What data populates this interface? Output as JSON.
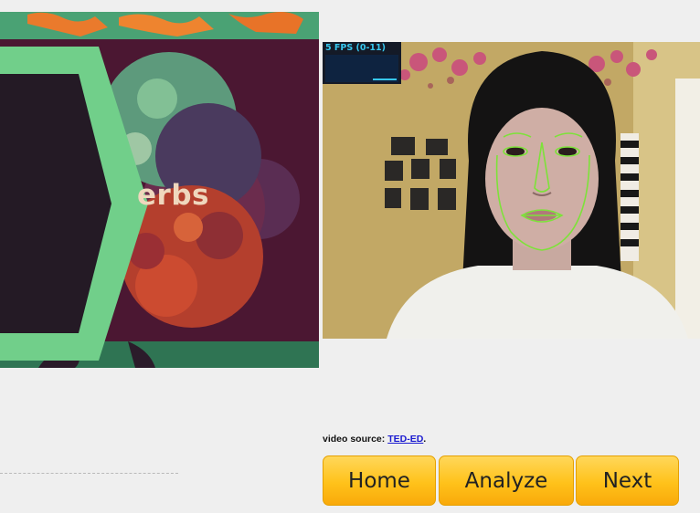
{
  "lesson_video": {
    "visible_word": "erbs"
  },
  "webcam": {
    "fps_label": "5 FPS (0-11)"
  },
  "progress": {
    "fraction": 0.0
  },
  "source": {
    "prefix": "video source: ",
    "link_text": "TED-ED",
    "suffix": "."
  },
  "buttons": {
    "home": "Home",
    "analyze": "Analyze",
    "next": "Next"
  },
  "colors": {
    "button_gradient_top": "#ffd75a",
    "button_gradient_bottom": "#f9a90a",
    "fps_text": "#37c7ee",
    "face_mesh": "#7de23a",
    "link": "#1a1ad0"
  },
  "icons": {
    "face_mesh": "face-landmark-overlay"
  }
}
